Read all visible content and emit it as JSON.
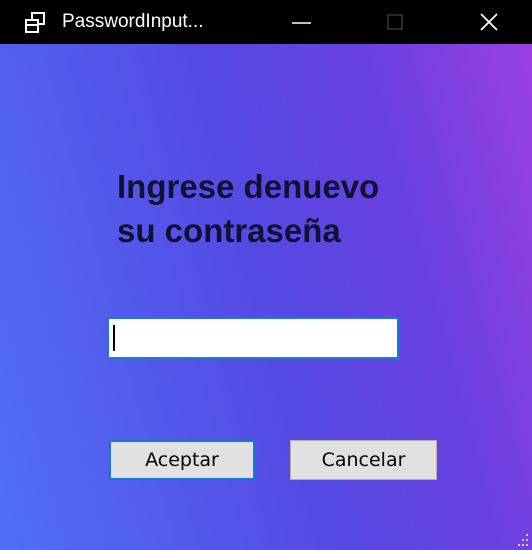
{
  "window": {
    "title": "PasswordInput...",
    "icons": {
      "app": "window-restore-icon",
      "minimize": "minimize-icon",
      "maximize": "maximize-icon",
      "close": "close-icon",
      "grip": "resize-grip-icon"
    }
  },
  "dialog": {
    "prompt_line1": "Ingrese denuevo",
    "prompt_line2": "su contraseña",
    "password_value": "",
    "accept_label": "Aceptar",
    "cancel_label": "Cancelar"
  },
  "colors": {
    "titlebar": "#000000",
    "gradient_start": "#4f6ff7",
    "gradient_mid": "#5548e3",
    "gradient_end": "#9a3fe2",
    "prompt_text": "#111132",
    "focus_border": "#1a76d2",
    "button_face": "#e1e1e1"
  }
}
